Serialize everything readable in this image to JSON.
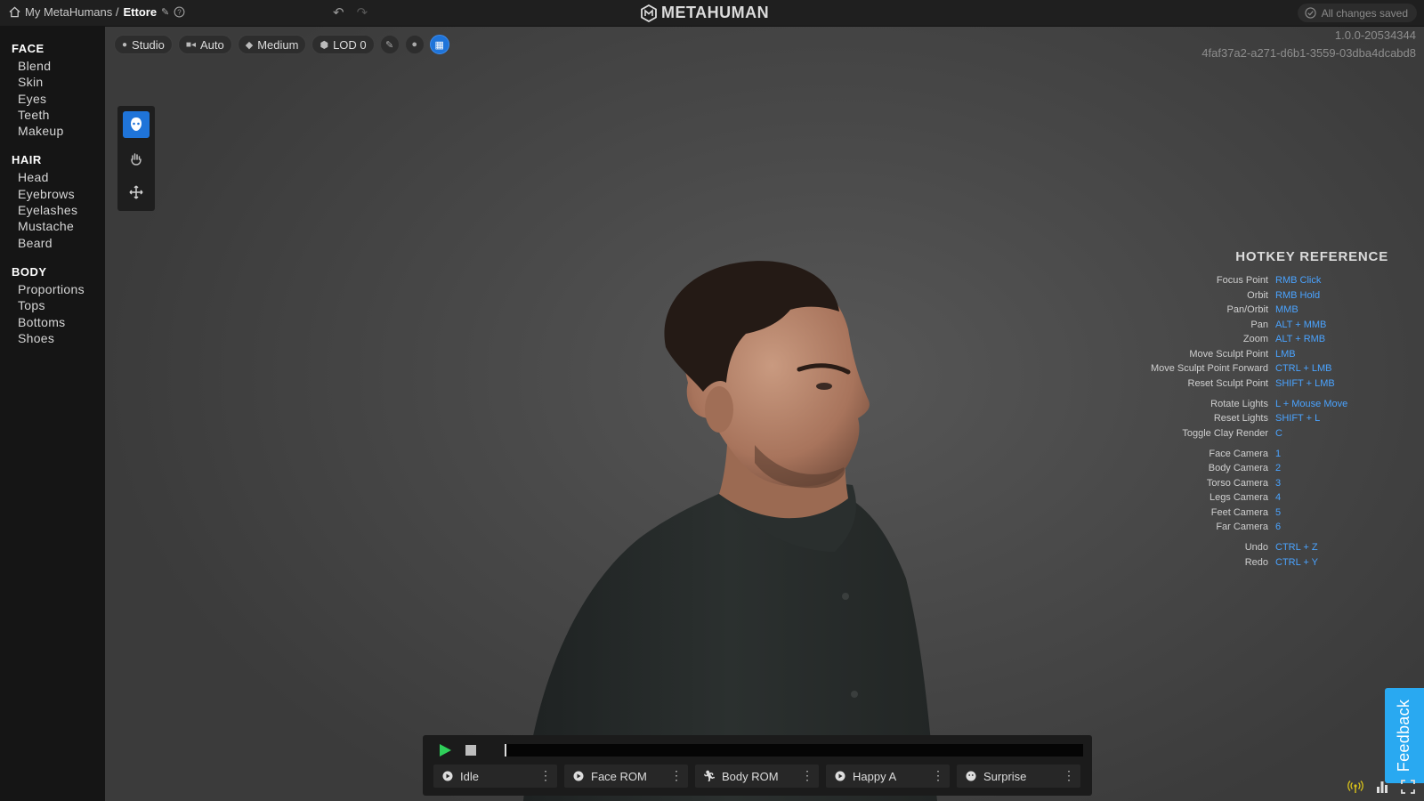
{
  "topbar": {
    "breadcrumb_root": "My MetaHumans /",
    "character_name": "Ettore",
    "logo_text": "METAHUMAN",
    "save_status": "All changes saved"
  },
  "sidebar": {
    "sections": [
      {
        "title": "FACE",
        "items": [
          "Blend",
          "Skin",
          "Eyes",
          "Teeth",
          "Makeup"
        ]
      },
      {
        "title": "HAIR",
        "items": [
          "Head",
          "Eyebrows",
          "Eyelashes",
          "Mustache",
          "Beard"
        ]
      },
      {
        "title": "BODY",
        "items": [
          "Proportions",
          "Tops",
          "Bottoms",
          "Shoes"
        ]
      }
    ]
  },
  "viewport_toolbar": {
    "lighting": "Studio",
    "camera": "Auto",
    "quality": "Medium",
    "lod": "LOD 0"
  },
  "version": {
    "build": "1.0.0-20534344",
    "id": "4faf37a2-a271-d6b1-3559-03dba4dcabd8"
  },
  "hotkeys": {
    "title": "HOTKEY REFERENCE",
    "rows": [
      {
        "label": "Focus Point",
        "key": "RMB Click"
      },
      {
        "label": "Orbit",
        "key": "RMB Hold"
      },
      {
        "label": "Pan/Orbit",
        "key": "MMB"
      },
      {
        "label": "Pan",
        "key": "ALT + MMB"
      },
      {
        "label": "Zoom",
        "key": "ALT + RMB"
      },
      {
        "label": "Move Sculpt Point",
        "key": "LMB"
      },
      {
        "label": "Move Sculpt Point Forward",
        "key": "CTRL + LMB"
      },
      {
        "label": "Reset Sculpt Point",
        "key": "SHIFT + LMB"
      },
      {
        "label": "Rotate Lights",
        "key": "L + Mouse Move"
      },
      {
        "label": "Reset Lights",
        "key": "SHIFT + L"
      },
      {
        "label": "Toggle Clay Render",
        "key": "C"
      },
      {
        "label": "Face Camera",
        "key": "1"
      },
      {
        "label": "Body Camera",
        "key": "2"
      },
      {
        "label": "Torso Camera",
        "key": "3"
      },
      {
        "label": "Legs Camera",
        "key": "4"
      },
      {
        "label": "Feet Camera",
        "key": "5"
      },
      {
        "label": "Far Camera",
        "key": "6"
      },
      {
        "label": "Undo",
        "key": "CTRL + Z"
      },
      {
        "label": "Redo",
        "key": "CTRL + Y"
      }
    ]
  },
  "player": {
    "animations": [
      "Idle",
      "Face ROM",
      "Body ROM",
      "Happy A",
      "Surprise"
    ]
  },
  "feedback_label": "Feedback",
  "colors": {
    "accent_blue": "#1f74d9",
    "hotkey_blue": "#4aa3ff",
    "play_green": "#2fcf5a",
    "feedback_blue": "#29a9f1"
  }
}
